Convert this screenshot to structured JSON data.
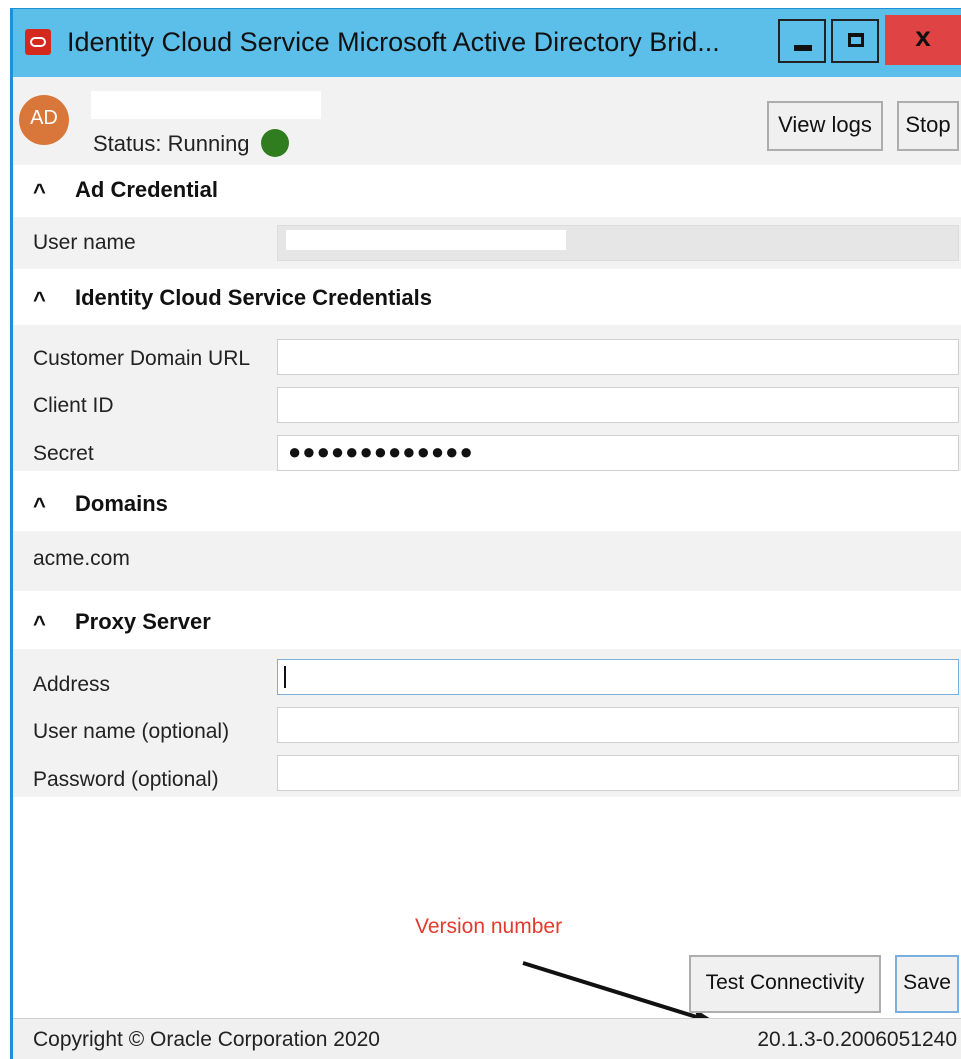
{
  "window": {
    "title": "Identity Cloud Service Microsoft Active Directory Brid...",
    "close_glyph": "x"
  },
  "header": {
    "avatar_initials": "AD",
    "status_text": "Status:  Running",
    "status_color": "#2f7d1e",
    "view_logs_label": "View logs",
    "stop_label": "Stop"
  },
  "sections": {
    "ad_credential": {
      "title": "Ad Credential",
      "user_name_label": "User name"
    },
    "ics_credentials": {
      "title": "Identity Cloud Service Credentials",
      "domain_url_label": "Customer Domain URL",
      "client_id_label": "Client ID",
      "secret_label": "Secret",
      "secret_value": "●●●●●●●●●●●●●"
    },
    "domains": {
      "title": "Domains",
      "items": [
        "acme.com"
      ]
    },
    "proxy": {
      "title": "Proxy Server",
      "address_label": "Address",
      "username_label": "User name (optional)",
      "password_label": "Password (optional)"
    }
  },
  "chevron_glyph": "^",
  "annotation": {
    "text": "Version number",
    "color": "#e23b2e"
  },
  "footer": {
    "test_connectivity_label": "Test Connectivity",
    "save_label": "Save",
    "copyright": "Copyright © Oracle Corporation 2020",
    "version": "20.1.3-0.2006051240"
  }
}
